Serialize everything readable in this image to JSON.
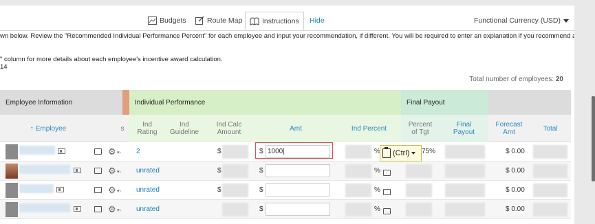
{
  "tabs": {
    "budgets": "Budgets",
    "route_map": "Route Map",
    "instructions": "Instructions",
    "hide": "Hide"
  },
  "currency": "Functional Currency (USD)",
  "instructions": {
    "line1": "wn below. Review the \"Recommended Individual Performance Percent\" for each employee and input your recommendation, if different. You will be required to enter an explanation if you recommend a",
    "line2": "\" column for more details about each employee's incentive award calculation.",
    "line3": "14"
  },
  "total": {
    "label": "Total number of employees:",
    "value": "20"
  },
  "groups": {
    "employee_info": "Employee Information",
    "individual_performance": "Individual Performance",
    "final_payout": "Final Payout"
  },
  "columns": {
    "employee": "Employee",
    "s": "s",
    "ind_rating": "Ind\nRating",
    "ind_guideline": "Ind\nGuideline",
    "ind_calc_amount": "Ind Calc\nAmount",
    "amt": "Amt",
    "ind_percent": "Ind Percent",
    "percent_of_tgt": "Percent\nof Tgt",
    "final_payout": "Final\nPayout",
    "forecast_amt": "Forecast\nAmt",
    "total": "Total"
  },
  "rows": [
    {
      "rating": "2",
      "amt_value": "1000",
      "pct_symbol": "%",
      "pct_partial": "75%",
      "forecast": "$ 0.00",
      "dollar": "$"
    },
    {
      "rating": "unrated",
      "amt_value": "",
      "pct_symbol": "%",
      "forecast": "$ 0.00",
      "dollar": "$"
    },
    {
      "rating": "unrated",
      "amt_value": "",
      "pct_symbol": "%",
      "forecast": "$ 0.00",
      "dollar": "$"
    },
    {
      "rating": "unrated",
      "amt_value": "",
      "pct_symbol": "%",
      "forecast": "$ 0.00",
      "dollar": "$"
    }
  ],
  "paste_popup": {
    "label": "(Ctrl)"
  },
  "colors": {
    "link": "#1a80b6",
    "error_border": "#d9534f",
    "ind_perf_bg": "#d6efc6",
    "final_bg": "#cbead7"
  }
}
